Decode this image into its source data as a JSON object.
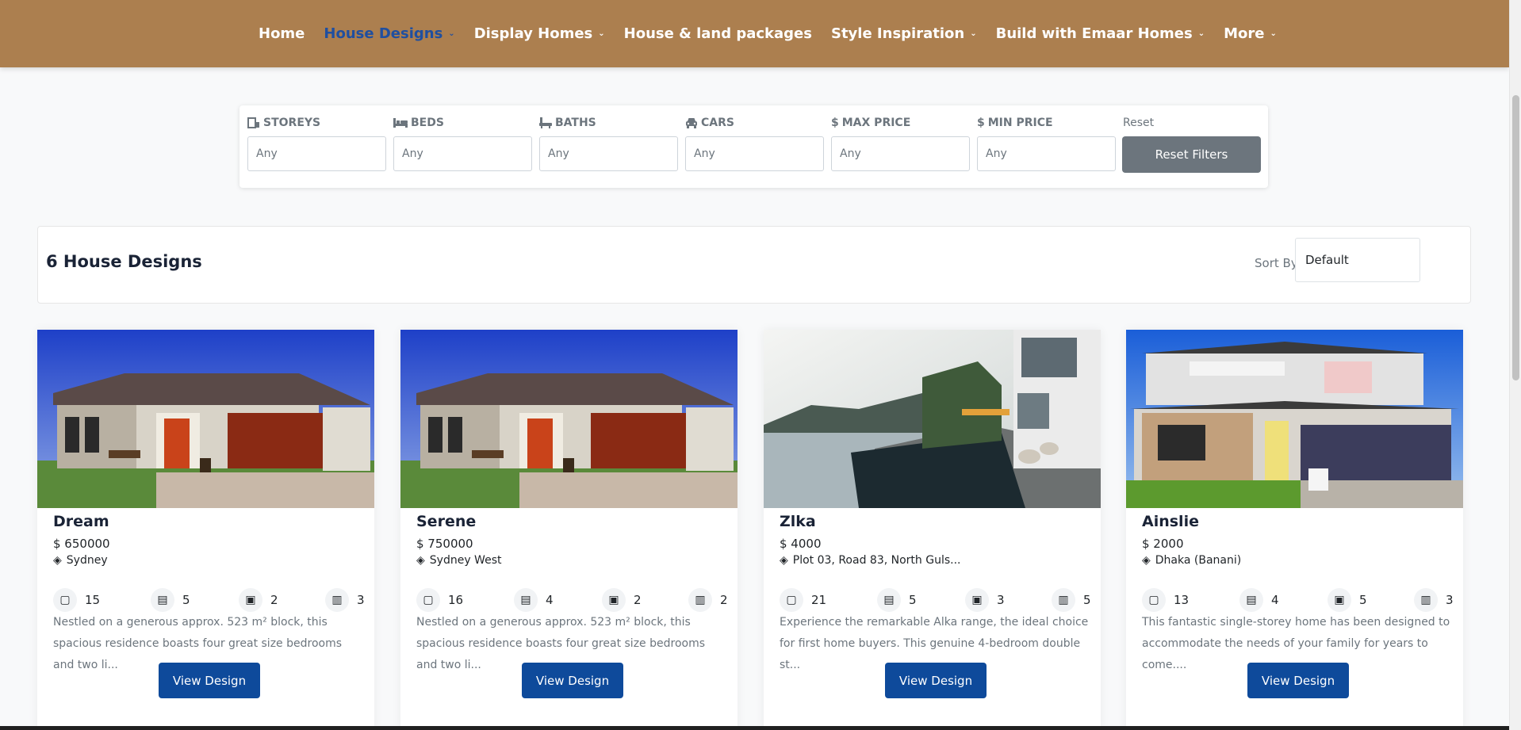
{
  "nav": {
    "items": [
      {
        "label": "Home",
        "has_dropdown": false
      },
      {
        "label": "House Designs",
        "has_dropdown": true,
        "active": true
      },
      {
        "label": "Display Homes",
        "has_dropdown": true
      },
      {
        "label": "House & land packages",
        "has_dropdown": false
      },
      {
        "label": "Style Inspiration",
        "has_dropdown": true
      },
      {
        "label": "Build with Emaar Homes",
        "has_dropdown": true
      },
      {
        "label": "More",
        "has_dropdown": true
      }
    ],
    "colors": {
      "background": "#ac7f4f",
      "active": "#1f4fa0"
    }
  },
  "filters": {
    "items": [
      {
        "label": "STOREYS",
        "icon": "storey-icon",
        "value": "Any"
      },
      {
        "label": "BEDS",
        "icon": "bed-icon",
        "value": "Any"
      },
      {
        "label": "BATHS",
        "icon": "bath-icon",
        "value": "Any"
      },
      {
        "label": "CARS",
        "icon": "car-icon",
        "value": "Any"
      },
      {
        "label": "MAX PRICE",
        "icon": "dollar-icon",
        "value": "Any"
      },
      {
        "label": "MIN PRICE",
        "icon": "dollar-icon",
        "value": "Any"
      }
    ],
    "reset_label": "Reset",
    "reset_button": "Reset Filters"
  },
  "results": {
    "title": "6 House Designs",
    "sort_label": "Sort By:",
    "sort_value": "Default"
  },
  "cards": [
    {
      "title": "Dream",
      "price": "$ 650000",
      "location": "Sydney",
      "storeys": "15",
      "beds": "5",
      "cars": "2",
      "baths": "3",
      "description": "Nestled on a generous approx. 523 m² block, this spacious residence boasts four great size bedrooms and two li...",
      "button": "View Design",
      "image": "house-facade"
    },
    {
      "title": "Serene",
      "price": "$ 750000",
      "location": "Sydney West",
      "storeys": "16",
      "beds": "4",
      "cars": "2",
      "baths": "2",
      "description": "Nestled on a generous approx. 523 m² block, this spacious residence boasts four great size bedrooms and two li...",
      "button": "View Design",
      "image": "house-facade"
    },
    {
      "title": "Zlka",
      "price": "$ 4000",
      "location": "Plot 03, Road 83, North Guls...",
      "storeys": "21",
      "beds": "5",
      "cars": "3",
      "baths": "5",
      "description": "Experience the remarkable Alka range, the ideal choice for first home buyers. This genuine 4-bedroom double st...",
      "button": "View Design",
      "image": "infinity-pool"
    },
    {
      "title": "Ainslie",
      "price": "$ 2000",
      "location": "Dhaka (Banani)",
      "storeys": "13",
      "beds": "4",
      "cars": "5",
      "baths": "3",
      "description": "This fantastic single-storey home has been designed to accommodate the needs of your family for years to come....",
      "button": "View Design",
      "image": "double-storey-house"
    }
  ]
}
